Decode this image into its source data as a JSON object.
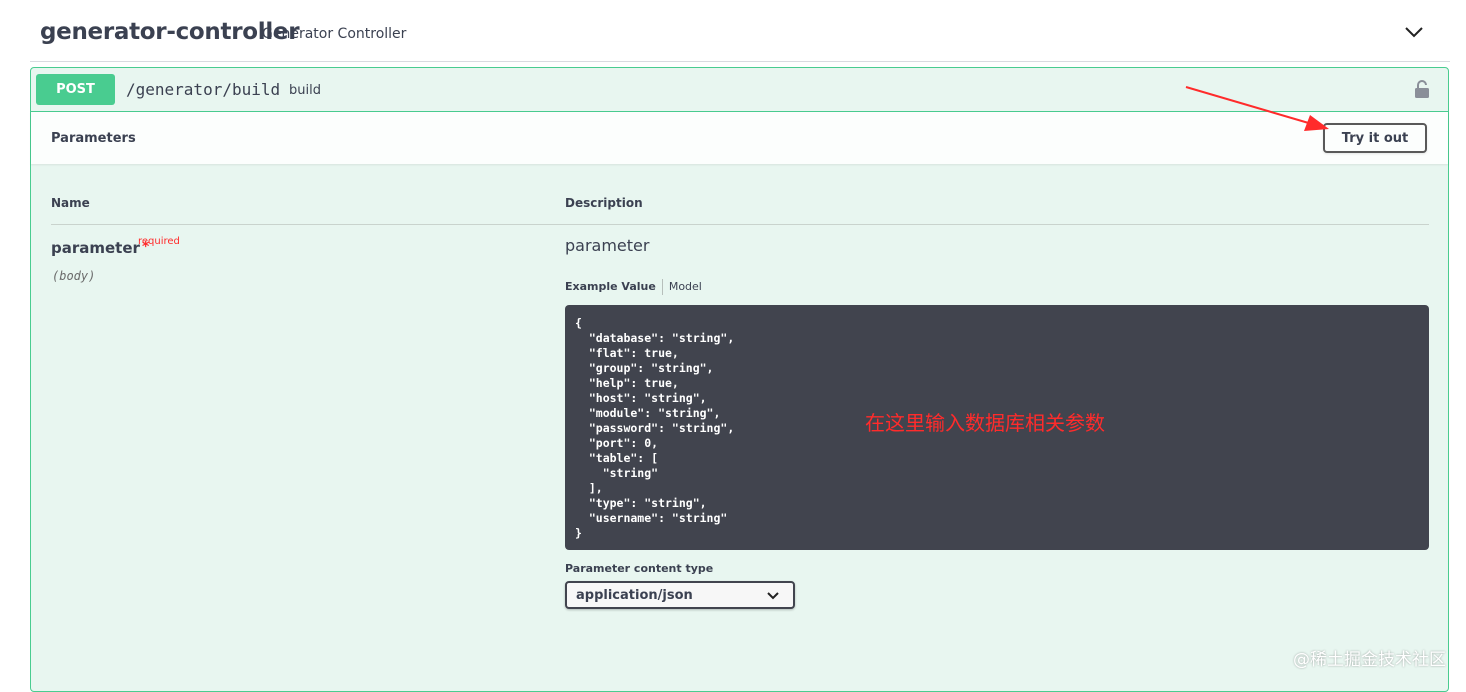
{
  "tag": {
    "name": "generator-controller",
    "description": "Generator Controller"
  },
  "operation": {
    "method": "POST",
    "path": "/generator/build",
    "summary": "build"
  },
  "parameters_section": {
    "title": "Parameters",
    "try_button_label": "Try it out"
  },
  "table": {
    "col_name": "Name",
    "col_description": "Description"
  },
  "parameter": {
    "name": "parameter",
    "required_star": "*",
    "required_label": "required",
    "location": "(body)",
    "description": "parameter",
    "tab_example": "Example Value",
    "tab_model": "Model",
    "example_json": "{\n  \"database\": \"string\",\n  \"flat\": true,\n  \"group\": \"string\",\n  \"help\": true,\n  \"host\": \"string\",\n  \"module\": \"string\",\n  \"password\": \"string\",\n  \"port\": 0,\n  \"table\": [\n    \"string\"\n  ],\n  \"type\": \"string\",\n  \"username\": \"string\"\n}",
    "annotation": "在这里输入数据库相关参数",
    "content_type_label": "Parameter content type",
    "content_type_value": "application/json"
  },
  "watermark": "@稀土掘金技术社区",
  "colors": {
    "post_green": "#49cc90",
    "opblock_bg": "#e8f6f0",
    "code_bg": "#41444e",
    "annotation_red": "#ff2b2b"
  },
  "icons": {
    "collapse": "chevron-down-icon",
    "lock": "lock-icon",
    "select": "chevron-down-icon"
  }
}
